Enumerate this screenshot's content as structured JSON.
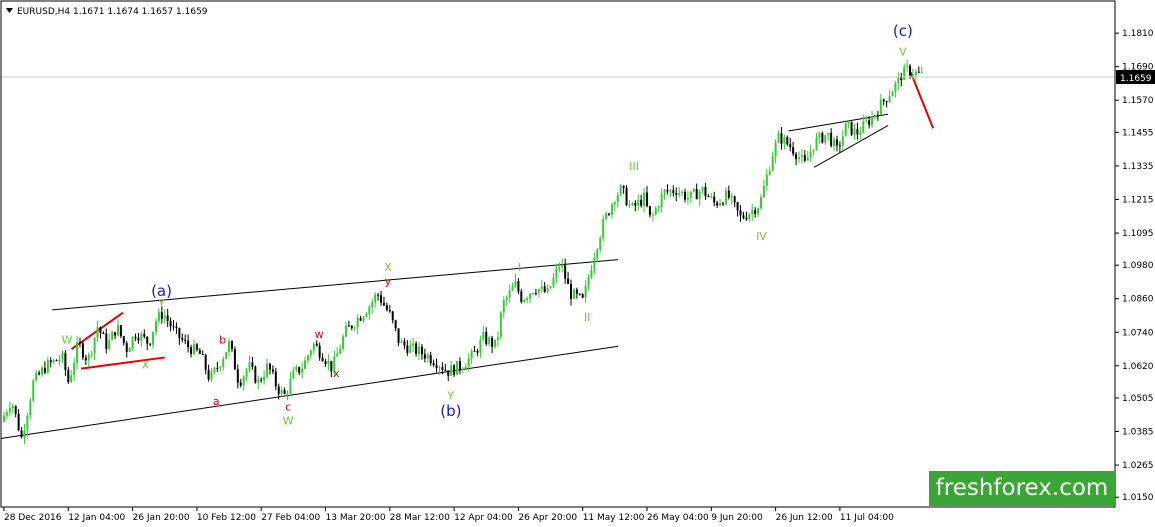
{
  "chart_data": {
    "type": "candlestick",
    "title": "EURUSD,H4  1.1671 1.1674 1.1657 1.1659",
    "symbol": "EURUSD",
    "timeframe": "H4",
    "ohlc": {
      "open": 1.1671,
      "high": 1.1674,
      "low": 1.1657,
      "close": 1.1659
    },
    "current_price_label": "1.1659",
    "ylim": [
      1.0115,
      1.1925
    ],
    "y_ticks": [
      "1.1810",
      "1.1690",
      "1.1570",
      "1.1455",
      "1.1335",
      "1.1215",
      "1.1095",
      "1.0980",
      "1.0860",
      "1.0740",
      "1.0620",
      "1.0505",
      "1.0385",
      "1.0265",
      "1.0150"
    ],
    "x_ticks": [
      "28 Dec 2016",
      "12 Jan 04:00",
      "26 Jan 20:00",
      "10 Feb 12:00",
      "27 Feb 04:00",
      "13 Mar 20:00",
      "28 Mar 12:00",
      "12 Apr 04:00",
      "26 Apr 20:00",
      "11 May 12:00",
      "26 May 04:00",
      "9 Jun 20:00",
      "26 Jun 12:00",
      "11 Jul 04:00"
    ],
    "x_range": [
      0,
      14
    ],
    "price_path": [
      [
        0.0,
        1.042
      ],
      [
        0.16,
        1.05
      ],
      [
        0.32,
        1.036
      ],
      [
        0.5,
        1.056
      ],
      [
        0.7,
        1.062
      ],
      [
        0.95,
        1.065
      ],
      [
        1.05,
        1.056
      ],
      [
        1.2,
        1.07
      ],
      [
        1.35,
        1.064
      ],
      [
        1.5,
        1.076
      ],
      [
        1.65,
        1.069
      ],
      [
        1.8,
        1.076
      ],
      [
        1.95,
        1.068
      ],
      [
        2.1,
        1.074
      ],
      [
        2.3,
        1.07
      ],
      [
        2.4,
        1.078
      ],
      [
        2.52,
        1.081
      ],
      [
        2.7,
        1.074
      ],
      [
        2.9,
        1.069
      ],
      [
        3.1,
        1.066
      ],
      [
        3.25,
        1.057
      ],
      [
        3.4,
        1.063
      ],
      [
        3.55,
        1.07
      ],
      [
        3.7,
        1.056
      ],
      [
        3.85,
        1.062
      ],
      [
        4.0,
        1.056
      ],
      [
        4.15,
        1.062
      ],
      [
        4.28,
        1.055
      ],
      [
        4.4,
        1.051
      ],
      [
        4.55,
        1.059
      ],
      [
        4.7,
        1.062
      ],
      [
        4.85,
        1.07
      ],
      [
        5.0,
        1.066
      ],
      [
        5.15,
        1.061
      ],
      [
        5.35,
        1.074
      ],
      [
        5.55,
        1.079
      ],
      [
        5.75,
        1.084
      ],
      [
        5.85,
        1.088
      ],
      [
        6.05,
        1.08
      ],
      [
        6.2,
        1.07
      ],
      [
        6.4,
        1.068
      ],
      [
        6.6,
        1.066
      ],
      [
        6.8,
        1.063
      ],
      [
        6.95,
        1.06
      ],
      [
        7.15,
        1.062
      ],
      [
        7.35,
        1.066
      ],
      [
        7.5,
        1.072
      ],
      [
        7.7,
        1.069
      ],
      [
        7.8,
        1.084
      ],
      [
        8.0,
        1.091
      ],
      [
        8.1,
        1.086
      ],
      [
        8.3,
        1.09
      ],
      [
        8.5,
        1.088
      ],
      [
        8.7,
        1.099
      ],
      [
        8.85,
        1.088
      ],
      [
        9.05,
        1.085
      ],
      [
        9.2,
        1.1
      ],
      [
        9.35,
        1.112
      ],
      [
        9.55,
        1.123
      ],
      [
        9.65,
        1.125
      ],
      [
        9.8,
        1.118
      ],
      [
        10.0,
        1.122
      ],
      [
        10.1,
        1.114
      ],
      [
        10.3,
        1.124
      ],
      [
        10.5,
        1.125
      ],
      [
        10.7,
        1.122
      ],
      [
        10.9,
        1.125
      ],
      [
        11.1,
        1.12
      ],
      [
        11.3,
        1.123
      ],
      [
        11.5,
        1.115
      ],
      [
        11.65,
        1.117
      ],
      [
        11.8,
        1.12
      ],
      [
        12.0,
        1.138
      ],
      [
        12.1,
        1.144
      ],
      [
        12.3,
        1.14
      ],
      [
        12.5,
        1.134
      ],
      [
        12.65,
        1.142
      ],
      [
        12.85,
        1.145
      ],
      [
        13.0,
        1.139
      ],
      [
        13.15,
        1.148
      ],
      [
        13.3,
        1.145
      ],
      [
        13.55,
        1.151
      ],
      [
        13.7,
        1.156
      ],
      [
        13.9,
        1.162
      ],
      [
        14.0,
        1.166
      ],
      [
        14.1,
        1.1679
      ],
      [
        14.3,
        1.1659
      ]
    ],
    "channel_lines": [
      {
        "color": "#000000",
        "points": [
          [
            -0.05,
            1.036
          ],
          [
            9.55,
            1.069
          ]
        ]
      },
      {
        "color": "#000000",
        "points": [
          [
            0.75,
            1.082
          ],
          [
            9.55,
            1.1
          ]
        ]
      },
      {
        "color": "#000000",
        "points": [
          [
            12.2,
            1.146
          ],
          [
            13.75,
            1.152
          ]
        ]
      },
      {
        "color": "#000000",
        "points": [
          [
            12.6,
            1.133
          ],
          [
            13.75,
            1.148
          ]
        ]
      },
      {
        "color": "#e60000",
        "points": [
          [
            1.05,
            1.068
          ],
          [
            1.85,
            1.081
          ]
        ]
      },
      {
        "color": "#e60000",
        "points": [
          [
            1.2,
            1.061
          ],
          [
            2.5,
            1.065
          ]
        ]
      },
      {
        "color": "#e60000",
        "points": [
          [
            14.1,
            1.167
          ],
          [
            14.45,
            1.147
          ]
        ]
      }
    ],
    "annotations": [
      {
        "text": "W",
        "color": "green",
        "x": 0.98,
        "y": 1.07
      },
      {
        "text": "X",
        "color": "green",
        "x": 2.2,
        "y": 1.061
      },
      {
        "text": "Y",
        "color": "green",
        "x": 2.45,
        "y": 1.083
      },
      {
        "text": "(a)",
        "color": "blue",
        "x": 2.45,
        "y": 1.087
      },
      {
        "text": "b",
        "color": "red",
        "x": 3.4,
        "y": 1.07
      },
      {
        "text": "a",
        "color": "red",
        "x": 3.3,
        "y": 1.048
      },
      {
        "text": "c",
        "color": "red",
        "x": 4.42,
        "y": 1.046
      },
      {
        "text": "W",
        "color": "green",
        "x": 4.42,
        "y": 1.041
      },
      {
        "text": "w",
        "color": "red",
        "x": 4.9,
        "y": 1.072
      },
      {
        "text": "x",
        "color": "red",
        "x": 5.17,
        "y": 1.058
      },
      {
        "text": "X",
        "color": "green",
        "x": 5.97,
        "y": 1.096
      },
      {
        "text": "y",
        "color": "red",
        "x": 5.97,
        "y": 1.091
      },
      {
        "text": "Y",
        "color": "green",
        "x": 6.95,
        "y": 1.05
      },
      {
        "text": "(b)",
        "color": "blue",
        "x": 6.95,
        "y": 1.044
      },
      {
        "text": "I",
        "color": "green",
        "x": 8.02,
        "y": 1.096
      },
      {
        "text": "II",
        "color": "green",
        "x": 9.07,
        "y": 1.078
      },
      {
        "text": "III",
        "color": "green",
        "x": 9.8,
        "y": 1.132
      },
      {
        "text": "IV",
        "color": "green",
        "x": 11.78,
        "y": 1.107
      },
      {
        "text": "V",
        "color": "green",
        "x": 13.98,
        "y": 1.173
      },
      {
        "text": "(c)",
        "color": "blue",
        "x": 13.98,
        "y": 1.18
      }
    ],
    "grid": false,
    "current_price_line": true
  },
  "watermark": "freshforex.com",
  "colors": {
    "bull": "#33cc33",
    "bear": "#000000",
    "label_green": "#66cc33",
    "label_red": "#e60000",
    "label_blue": "#1a1acc",
    "watermark_bg": "#3aa635"
  }
}
